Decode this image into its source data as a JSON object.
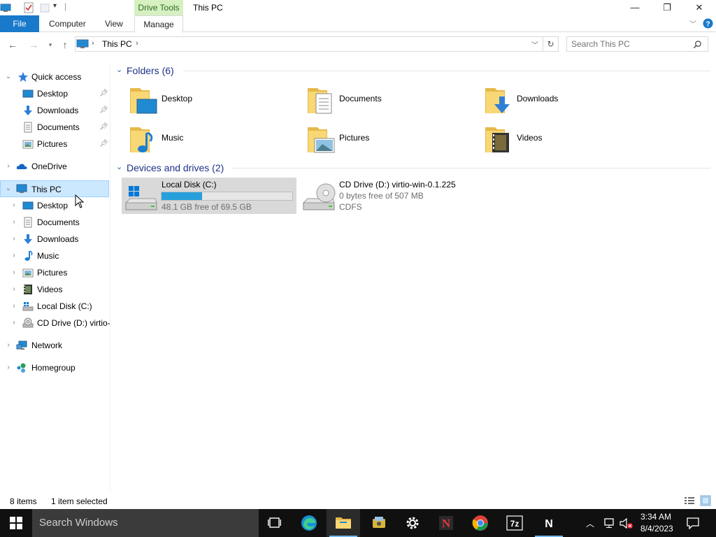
{
  "titlebar": {
    "context_tab": "Drive Tools",
    "title": "This PC",
    "minimize": "—",
    "maximize": "❐",
    "close": "✕"
  },
  "ribbon": {
    "tabs": [
      "File",
      "Computer",
      "View",
      "Manage"
    ]
  },
  "address": {
    "path": [
      "This PC"
    ],
    "search_placeholder": "Search This PC"
  },
  "nav": {
    "items": [
      {
        "label": "Quick access",
        "icon": "star-icon",
        "pinned": false
      },
      {
        "label": "Desktop",
        "icon": "desktop-icon",
        "pinned": true
      },
      {
        "label": "Downloads",
        "icon": "downloads-icon",
        "pinned": true
      },
      {
        "label": "Documents",
        "icon": "documents-icon",
        "pinned": true
      },
      {
        "label": "Pictures",
        "icon": "pictures-icon",
        "pinned": true
      },
      {
        "label": "OneDrive",
        "icon": "onedrive-icon"
      },
      {
        "label": "This PC",
        "icon": "this-pc-icon"
      },
      {
        "label": "Desktop",
        "icon": "desktop-icon"
      },
      {
        "label": "Documents",
        "icon": "documents-icon"
      },
      {
        "label": "Downloads",
        "icon": "downloads-icon"
      },
      {
        "label": "Music",
        "icon": "music-icon"
      },
      {
        "label": "Pictures",
        "icon": "pictures-icon"
      },
      {
        "label": "Videos",
        "icon": "videos-icon"
      },
      {
        "label": "Local Disk (C:)",
        "icon": "local-disk-icon"
      },
      {
        "label": "CD Drive (D:) virtio-",
        "icon": "cd-drive-icon"
      },
      {
        "label": "Network",
        "icon": "network-icon"
      },
      {
        "label": "Homegroup",
        "icon": "homegroup-icon"
      }
    ]
  },
  "content": {
    "folders_header": "Folders (6)",
    "folders": [
      {
        "label": "Desktop",
        "icon": "desktop-folder-icon"
      },
      {
        "label": "Documents",
        "icon": "documents-folder-icon"
      },
      {
        "label": "Downloads",
        "icon": "downloads-folder-icon"
      },
      {
        "label": "Music",
        "icon": "music-folder-icon"
      },
      {
        "label": "Pictures",
        "icon": "pictures-folder-icon"
      },
      {
        "label": "Videos",
        "icon": "videos-folder-icon"
      }
    ],
    "devices_header": "Devices and drives (2)",
    "drives": [
      {
        "name": "Local Disk (C:)",
        "free_text": "48.1 GB free of 69.5 GB",
        "used_fraction": 0.31
      },
      {
        "name": "CD Drive (D:) virtio-win-0.1.225",
        "free_text": "0 bytes free of 507 MB",
        "fs": "CDFS"
      }
    ]
  },
  "status": {
    "items": "8 items",
    "selected": "1 item selected"
  },
  "taskbar": {
    "search": "Search Windows",
    "time": "3:34 AM",
    "date": "8/4/2023"
  },
  "colors": {
    "accent": "#1979ca",
    "selection": "#cce8ff",
    "drive_bar": "#26a0da",
    "group_header": "#1e3287"
  }
}
